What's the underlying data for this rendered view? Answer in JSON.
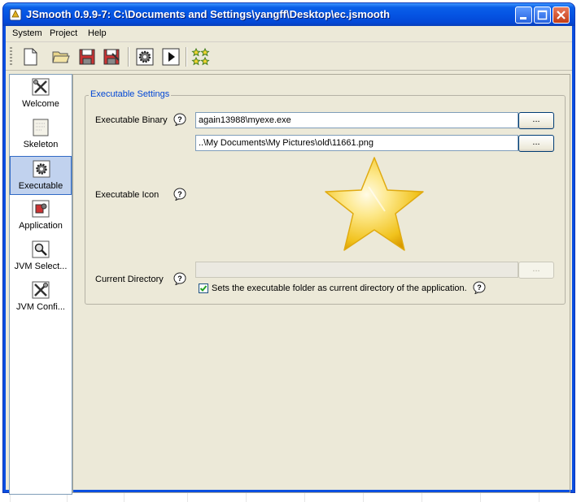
{
  "window": {
    "title": "JSmooth 0.9.9-7: C:\\Documents and Settings\\yangff\\Desktop\\ec.jsmooth"
  },
  "menubar": {
    "items": [
      {
        "label": "System"
      },
      {
        "label": "Project"
      },
      {
        "label": "Help"
      }
    ]
  },
  "toolbar": {
    "icons": [
      "new-file-icon",
      "open-folder-icon",
      "save-icon",
      "save-as-icon",
      "compile-gear-icon",
      "run-play-icon",
      "stars-icon"
    ]
  },
  "sidebar": {
    "items": [
      {
        "label": "Welcome",
        "icon": "welcome-tools-icon"
      },
      {
        "label": "Skeleton",
        "icon": "skeleton-page-icon"
      },
      {
        "label": "Executable",
        "icon": "executable-gear-icon",
        "selected": true
      },
      {
        "label": "Application",
        "icon": "application-icon"
      },
      {
        "label": "JVM Select...",
        "icon": "jvm-magnifier-icon"
      },
      {
        "label": "JVM Confi...",
        "icon": "jvm-config-tools-icon"
      }
    ]
  },
  "executable": {
    "group_title": "Executable Settings",
    "binary_label": "Executable Binary",
    "binary_value": "again13988\\myexe.exe",
    "binary_browse": "...",
    "icon_path_value": "..\\My Documents\\My Pictures\\old\\11661.png",
    "icon_browse": "...",
    "icon_label": "Executable Icon",
    "current_dir_label": "Current Directory",
    "current_dir_value": "",
    "current_dir_browse": "...",
    "checkbox_label": "Sets the executable folder as current directory of the application.",
    "checkbox_checked": true
  },
  "colors": {
    "titlebar": "#0554e3",
    "window_bg": "#ece9d8",
    "group_title": "#0046d5",
    "selection": "#c1d2ee"
  }
}
